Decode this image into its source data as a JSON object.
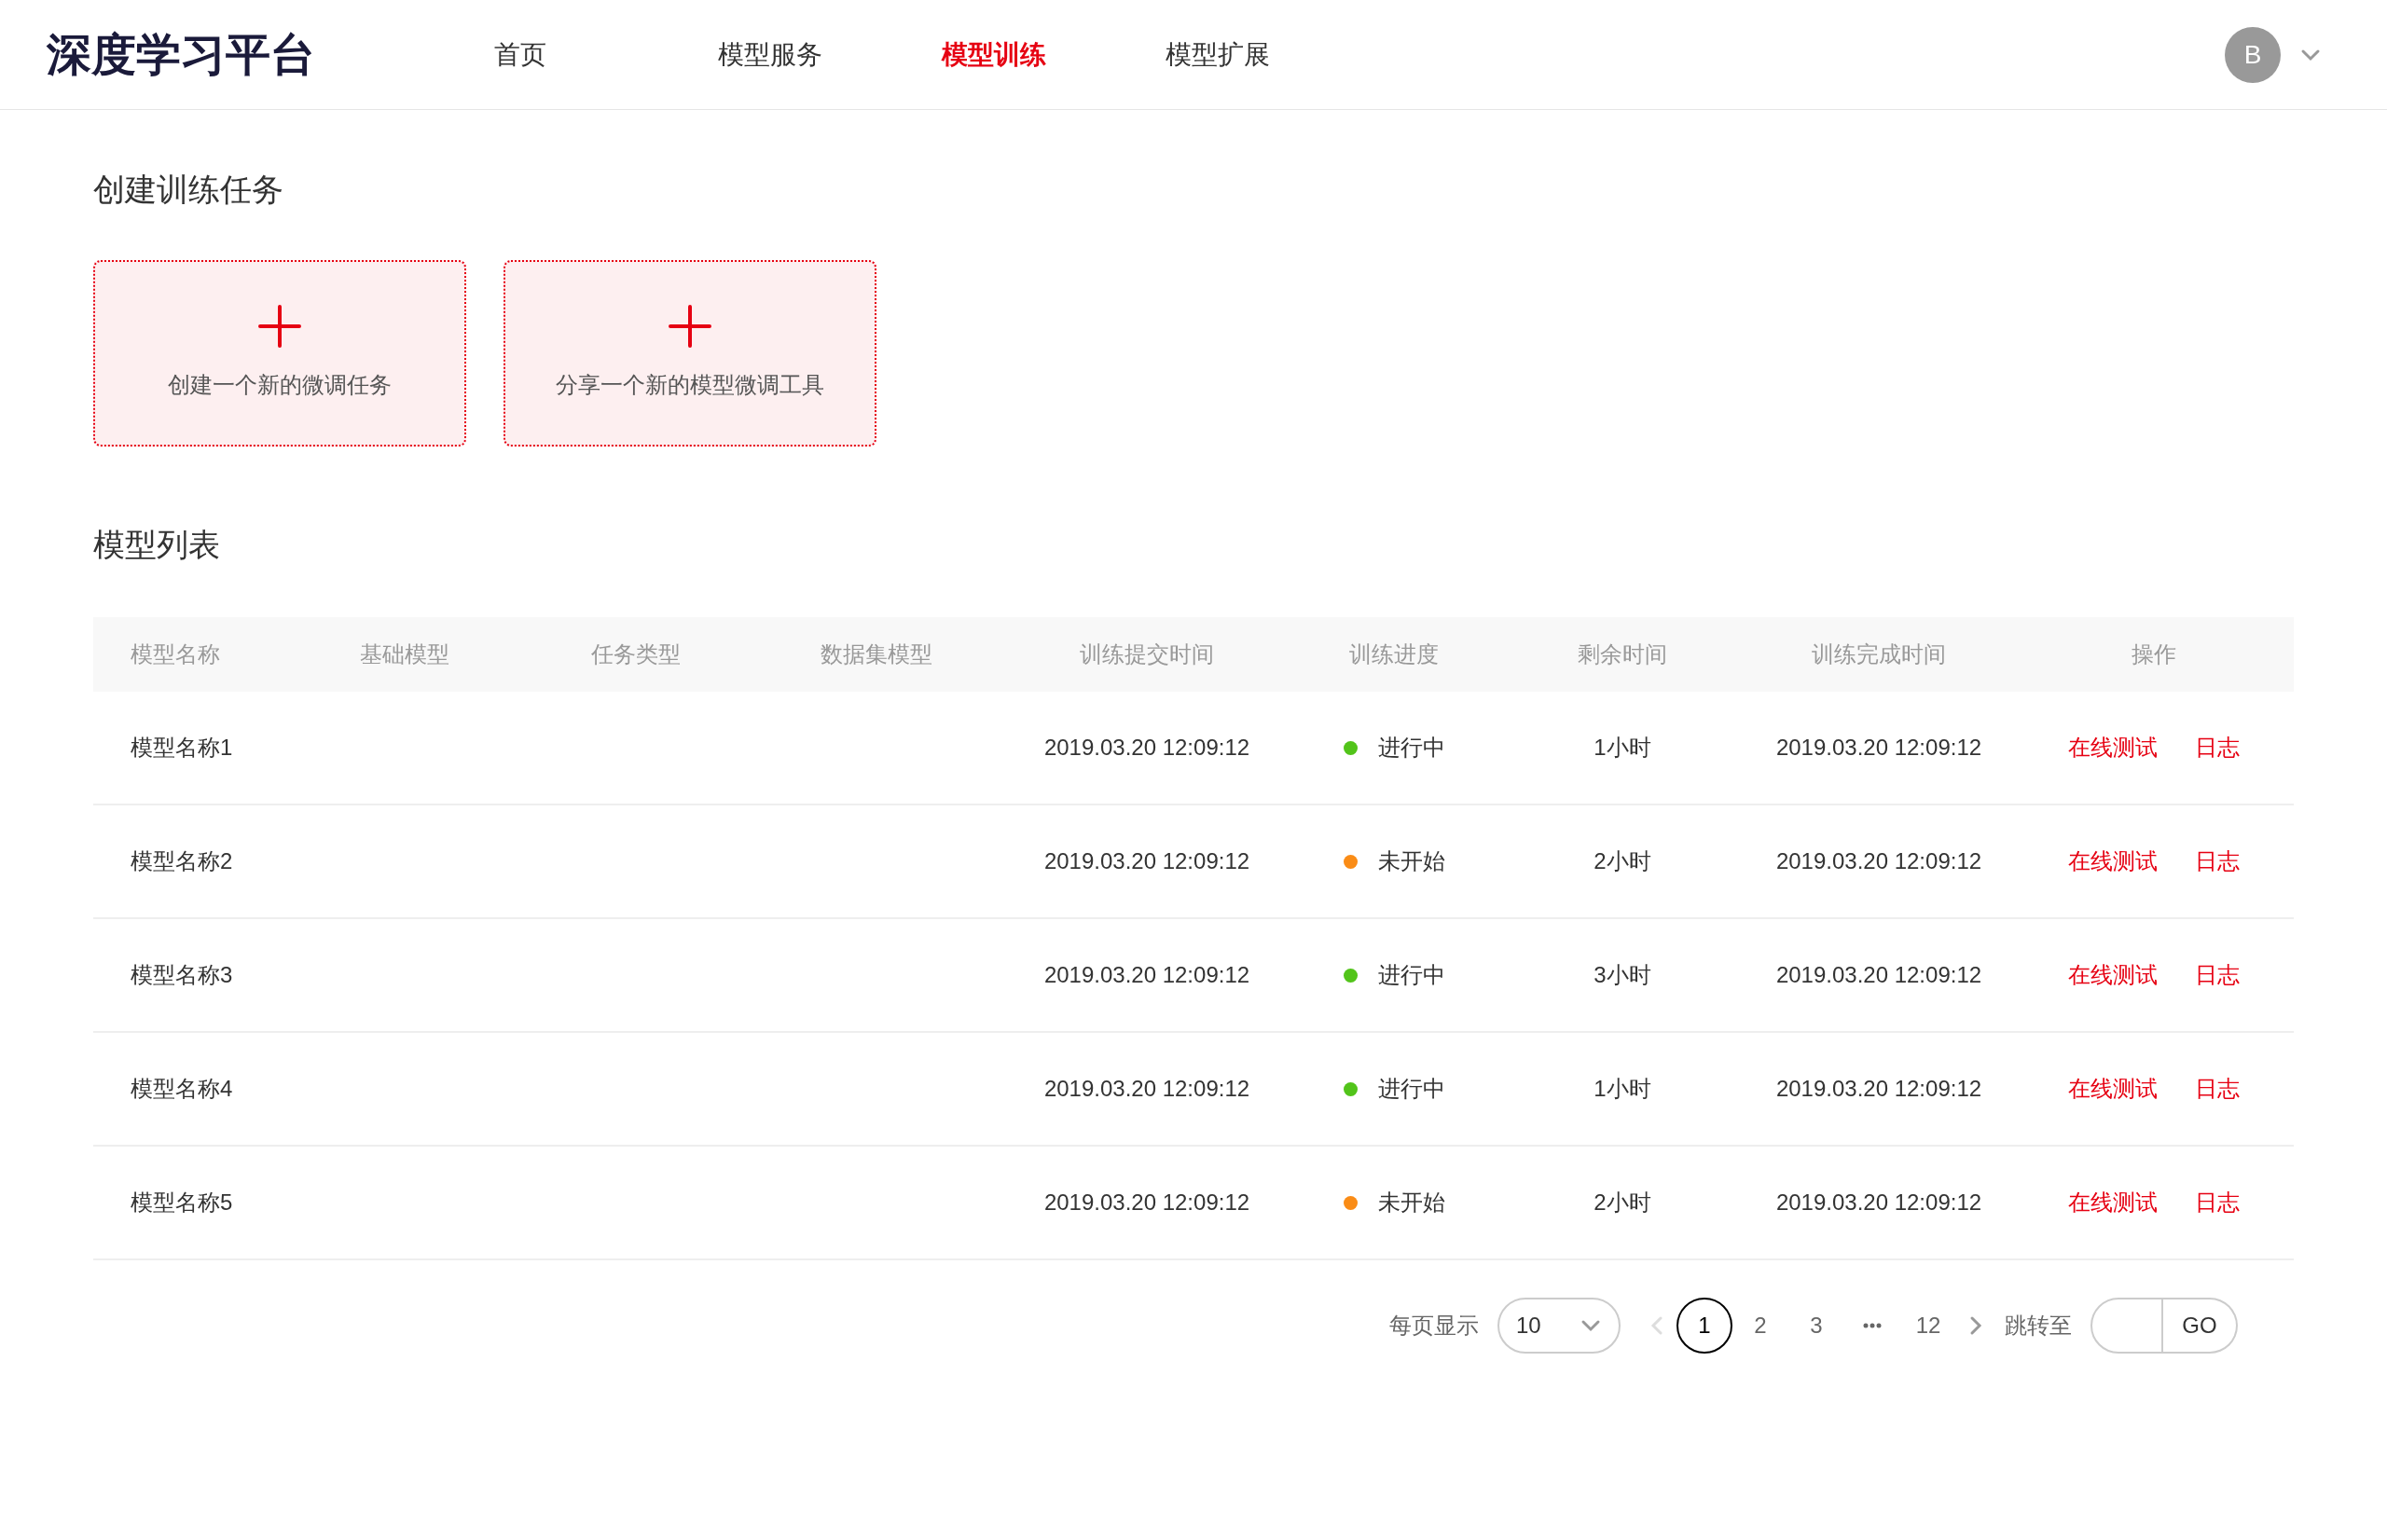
{
  "header": {
    "logo": "深度学习平台",
    "nav": [
      {
        "label": "首页",
        "selected": false
      },
      {
        "label": "模型服务",
        "selected": false
      },
      {
        "label": "模型训练",
        "selected": true
      },
      {
        "label": "模型扩展",
        "selected": false
      }
    ],
    "avatar": "B"
  },
  "create_section": {
    "title": "创建训练任务",
    "cards": [
      {
        "label": "创建一个新的微调任务"
      },
      {
        "label": "分享一个新的模型微调工具"
      }
    ]
  },
  "model_list": {
    "title": "模型列表",
    "columns": [
      "模型名称",
      "基础模型",
      "任务类型",
      "数据集模型",
      "训练提交时间",
      "训练进度",
      "剩余时间",
      "训练完成时间",
      "操作"
    ],
    "rows": [
      {
        "name": "模型名称1",
        "submit_time": "2019.03.20 12:09:12",
        "status": "进行中",
        "color": "#52c41a",
        "remaining": "1小时",
        "completed_time": "2019.03.20 12:09:12",
        "actions": [
          "在线测试",
          "日志"
        ]
      },
      {
        "name": "模型名称2",
        "submit_time": "2019.03.20 12:09:12",
        "status": "未开始",
        "color": "#fa8c16",
        "remaining": "2小时",
        "completed_time": "2019.03.20 12:09:12",
        "actions": [
          "在线测试",
          "日志"
        ]
      },
      {
        "name": "模型名称3",
        "submit_time": "2019.03.20 12:09:12",
        "status": "进行中",
        "color": "#52c41a",
        "remaining": "3小时",
        "completed_time": "2019.03.20 12:09:12",
        "actions": [
          "在线测试",
          "日志"
        ]
      },
      {
        "name": "模型名称4",
        "submit_time": "2019.03.20 12:09:12",
        "status": "进行中",
        "color": "#52c41a",
        "remaining": "1小时",
        "completed_time": "2019.03.20 12:09:12",
        "actions": [
          "在线测试",
          "日志"
        ]
      },
      {
        "name": "模型名称5",
        "submit_time": "2019.03.20 12:09:12",
        "status": "未开始",
        "color": "#fa8c16",
        "remaining": "2小时",
        "completed_time": "2019.03.20 12:09:12",
        "actions": [
          "在线测试",
          "日志"
        ]
      }
    ]
  },
  "pagination": {
    "page_size_label": "每页显示",
    "page_size": "10",
    "prev": {
      "disabled": true
    },
    "pages": [
      {
        "label": "1",
        "selected": true
      },
      {
        "label": "2",
        "selected": false
      },
      {
        "label": "3",
        "selected": false
      },
      {
        "kind": "ellipsis"
      },
      {
        "label": "12",
        "selected": false
      }
    ],
    "next": {
      "disabled": false
    },
    "jump_label": "跳转至",
    "go": "GO"
  }
}
